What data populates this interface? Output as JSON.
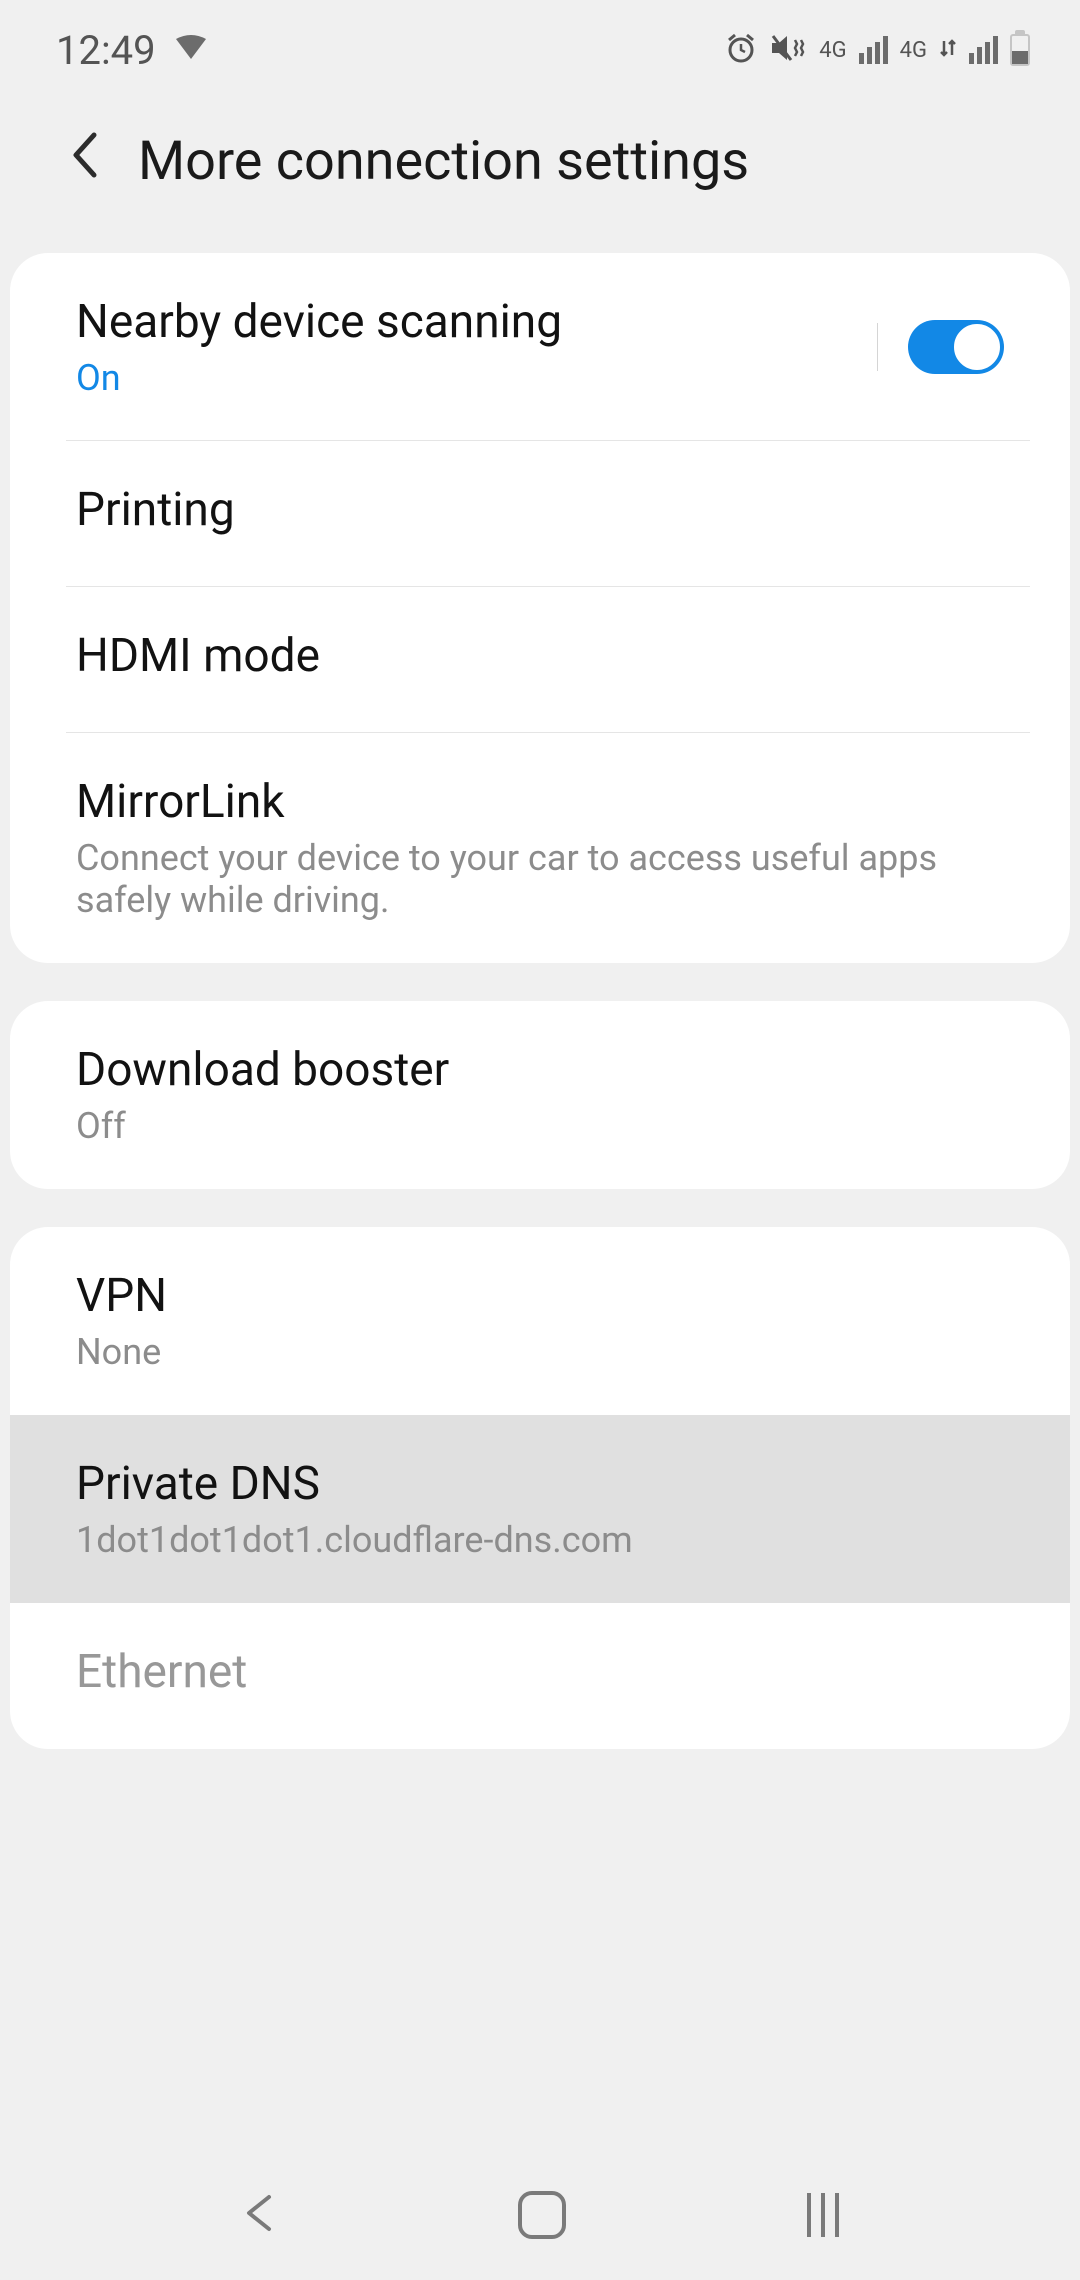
{
  "status_bar": {
    "time": "12:49",
    "network_label_1": "4G",
    "network_label_2": "4G"
  },
  "header": {
    "title": "More connection settings"
  },
  "group1": {
    "nearby": {
      "title": "Nearby device scanning",
      "status": "On",
      "toggle_on": true
    },
    "printing": {
      "title": "Printing"
    },
    "hdmi": {
      "title": "HDMI mode"
    },
    "mirrorlink": {
      "title": "MirrorLink",
      "subtitle": "Connect your device to your car to access useful apps safely while driving."
    }
  },
  "group2": {
    "download_booster": {
      "title": "Download booster",
      "status": "Off"
    }
  },
  "group3": {
    "vpn": {
      "title": "VPN",
      "status": "None"
    },
    "private_dns": {
      "title": "Private DNS",
      "value": "1dot1dot1dot1.cloudflare-dns.com"
    },
    "ethernet": {
      "title": "Ethernet"
    }
  }
}
